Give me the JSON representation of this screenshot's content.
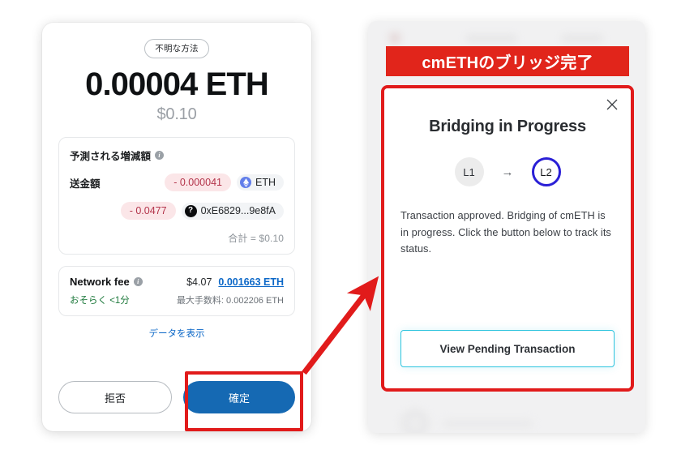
{
  "confirm_card": {
    "method_badge": "不明な方法",
    "amount_eth": "0.00004 ETH",
    "amount_fiat": "$0.10",
    "estimate": {
      "title": "予測される増減額",
      "info_icon": "info-icon",
      "rows": [
        {
          "label": "送金額",
          "delta": "- 0.000041",
          "asset": "ETH",
          "asset_icon": "eth-token-icon"
        },
        {
          "label": "",
          "delta": "- 0.0477",
          "asset": "0xE6829...9e8fA",
          "asset_icon": "unknown-token-icon"
        }
      ],
      "total": "合計 = $0.10"
    },
    "network_fee": {
      "label": "Network fee",
      "info_icon": "info-icon",
      "usd": "$4.07",
      "eth_link": "0.001663 ETH",
      "speed": "おそらく <1分",
      "max_fee": "最大手数料: 0.002206 ETH"
    },
    "show_data_link": "データを表示",
    "reject_button": "拒否",
    "confirm_button": "確定"
  },
  "bridge_panel": {
    "banner": "cmETHのブリッジ完了",
    "dialog": {
      "close_icon": "close-icon",
      "title": "Bridging in Progress",
      "hop_from": "L1",
      "hop_arrow": "→",
      "hop_to": "L2",
      "body": "Transaction approved. Bridging of cmETH is in progress. Click the button below to track its status.",
      "action_button": "View Pending Transaction"
    }
  },
  "annotations": {
    "highlight_color": "#e11b1b",
    "arrow_name": "red-pointer-arrow"
  },
  "colors": {
    "confirm_blue": "#1569b3",
    "banner_red": "#e1251b",
    "link_blue": "#0b67c7",
    "l2_ring": "#2a1fd6",
    "cta_cyan": "#2ec4de",
    "negative_pill_text": "#b3344a",
    "speed_green": "#1f7a3d"
  }
}
